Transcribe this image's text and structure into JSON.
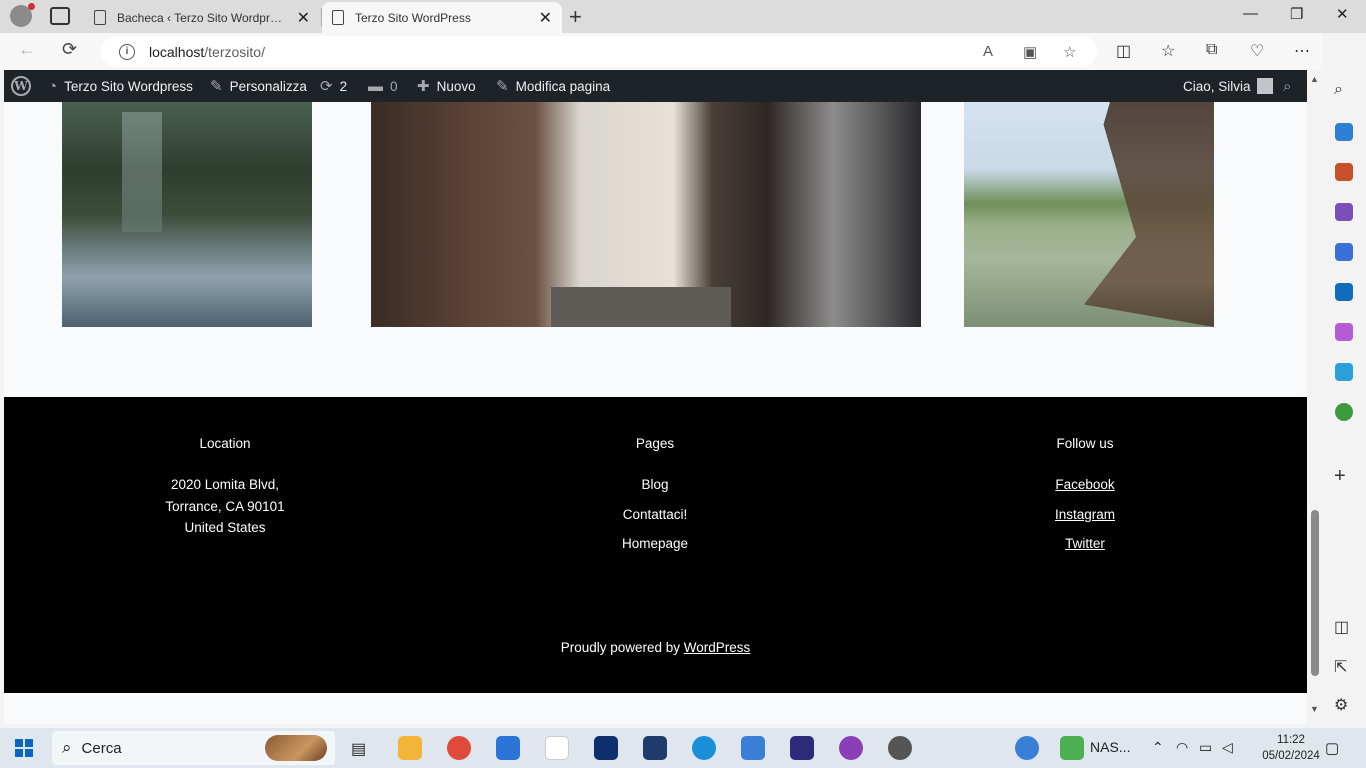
{
  "browser": {
    "tabs": [
      {
        "title": "Bacheca ‹ Terzo Sito Wordpress —",
        "active": false
      },
      {
        "title": "Terzo Sito WordPress",
        "active": true
      }
    ],
    "url_host": "localhost",
    "url_path": "/terzosito/"
  },
  "adminbar": {
    "site_name": "Terzo Sito Wordpress",
    "customize": "Personalizza",
    "updates_count": "2",
    "comments_count": "0",
    "new_label": "Nuovo",
    "edit_page": "Modifica pagina",
    "greeting": "Ciao, Silvia"
  },
  "footer": {
    "location": {
      "heading": "Location",
      "lines": [
        "2020 Lomita Blvd,",
        "Torrance, CA 90101",
        "United States"
      ]
    },
    "pages": {
      "heading": "Pages",
      "links": [
        "Blog",
        "Contattaci!",
        "Homepage"
      ]
    },
    "follow": {
      "heading": "Follow us",
      "links": [
        "Facebook",
        "Instagram",
        "Twitter"
      ]
    },
    "powered_prefix": "Proudly powered by ",
    "powered_link": "WordPress"
  },
  "taskbar": {
    "search_placeholder": "Cerca",
    "nas_label": "NAS...",
    "time": "11:22",
    "date": "05/02/2024"
  },
  "colors": {
    "admin_bar": "#1d2327",
    "footer_bg": "#000000",
    "page_bg": "#f9fafc",
    "accent": "#0a66c2"
  }
}
